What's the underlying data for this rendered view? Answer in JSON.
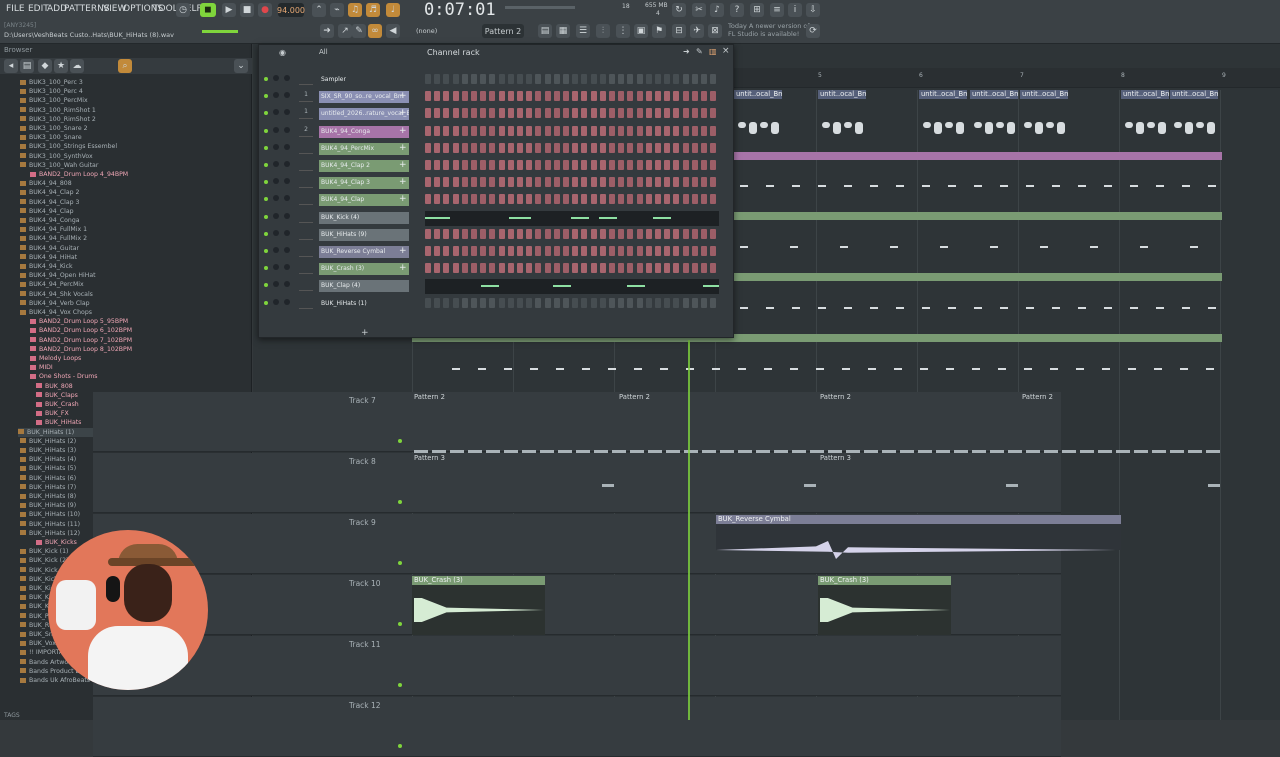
{
  "menu": [
    "FILE",
    "EDIT",
    "ADD",
    "PATTERNS",
    "VIEW",
    "OPTIONS",
    "TOOLS",
    "HELP"
  ],
  "tempo": "94.000",
  "clock": "0:07:01",
  "cpu": "18",
  "mem": "655 MB",
  "voices": "4",
  "pattern": "Pattern 2",
  "snap": "(none)",
  "hint": "[ANY3245]",
  "path": "D:\\Users\\VeshBeats Custo..Hats\\BUK_HiHats (8).wav",
  "news": [
    "Today  A newer version of",
    "FL Studio is available!"
  ],
  "browser": {
    "title": "Browser",
    "items": [
      "BUK3_100_Perc 3",
      "BUK3_100_Perc 4",
      "BUK3_100_PercMix",
      "BUK3_100_RimShot 1",
      "BUK3_100_RimShot 2",
      "BUK3_100_Snare 2",
      "BUK3_100_Snare",
      "BUK3_100_Strings Essembel",
      "BUK3_100_SynthVox",
      "BUK3_100_Wah Guitar",
      "BAND2_Drum Loop 4_94BPM",
      "BUK4_94_808",
      "BUK4_94_Clap 2",
      "BUK4_94_Clap 3",
      "BUK4_94_Clap",
      "BUK4_94_Conga",
      "BUK4_94_FullMix 1",
      "BUK4_94_FullMix 2",
      "BUK4_94_Guitar",
      "BUK4_94_HiHat",
      "BUK4_94_Kick",
      "BUK4_94_Open HiHat",
      "BUK4_94_PercMix",
      "BUK4_94_Shk Vocals",
      "BUK4_94_Verb Clap",
      "BUK4_94_Vox Chops",
      "BAND2_Drum Loop 5_95BPM",
      "BAND2_Drum Loop 6_102BPM",
      "BAND2_Drum Loop 7_102BPM",
      "BAND2_Drum Loop 8_102BPM",
      "Melody Loops",
      "MIDI",
      "One Shots - Drums",
      "BUK_808",
      "BUK_Claps",
      "BUK_Crash",
      "BUK_FX",
      "BUK_HiHats",
      "BUK_HiHats (1)",
      "BUK_HiHats (2)",
      "BUK_HiHats (3)",
      "BUK_HiHats (4)",
      "BUK_HiHats (5)",
      "BUK_HiHats (6)",
      "BUK_HiHats (7)",
      "BUK_HiHats (8)",
      "BUK_HiHats (9)",
      "BUK_HiHats (10)",
      "BUK_HiHats (11)",
      "BUK_HiHats (12)",
      "BUK_Kicks",
      "BUK_Kick (1)",
      "BUK_Kick (2)",
      "BUK_Kick (3)",
      "BUK_Kick (4)",
      "BUK_Kick (5)",
      "BUK_Kick (6)",
      "BUK_Kick (7)",
      "BUK_P",
      "BUK_Ri",
      "BUK_Sna",
      "BUK_Vox",
      "!! IMPORTANT MESSAGE - …  AFROSWING DRUM KIT",
      "Bands Artwork 7",
      "Bands Product Details",
      "Bands Uk AfroBeats x AfroSwing DEMO Track"
    ],
    "tags": "TAGS"
  },
  "rack": {
    "title": "Channel rack",
    "filter": "All",
    "channels": [
      {
        "num": "",
        "name": "Sampler",
        "color": "#343a3e",
        "mode": "steps"
      },
      {
        "num": "1",
        "name": "SIX_SR_90_so..re_vocal_Bm",
        "color": "#8a8fb3",
        "mode": "steps"
      },
      {
        "num": "1",
        "name": "untitled_2026..rature_vocal_Bm",
        "color": "#8a8fb3",
        "mode": "steps"
      },
      {
        "num": "2",
        "name": "BUK4_94_Conga",
        "color": "#a774a8",
        "mode": "steps"
      },
      {
        "num": "",
        "name": "BUK4_94_PercMix",
        "color": "#7a9b73",
        "mode": "steps"
      },
      {
        "num": "",
        "name": "BUK4_94_Clap 2",
        "color": "#7a9b73",
        "mode": "steps"
      },
      {
        "num": "",
        "name": "BUK4_94_Clap 3",
        "color": "#7a9b73",
        "mode": "steps"
      },
      {
        "num": "",
        "name": "BUK4_94_Clap",
        "color": "#7a9b73",
        "mode": "steps"
      },
      {
        "num": "",
        "name": "BUK_Kick (4)",
        "color": "#6a7378",
        "mode": "roll"
      },
      {
        "num": "",
        "name": "BUK_HiHats (9)",
        "color": "#6a7378",
        "mode": "steps"
      },
      {
        "num": "",
        "name": "BUK_Reverse Cymbal",
        "color": "#7c7e96",
        "mode": "steps"
      },
      {
        "num": "",
        "name": "BUK_Crash (3)",
        "color": "#7a9b73",
        "mode": "steps"
      },
      {
        "num": "",
        "name": "BUK_Clap (4)",
        "color": "#6a7378",
        "mode": "roll"
      },
      {
        "num": "",
        "name": "BUK_HiHats (1)",
        "color": "#343a3e",
        "mode": "steps"
      }
    ]
  },
  "playlist": {
    "bar_numbers": [
      "5",
      "6",
      "7",
      "8",
      "9"
    ],
    "vocal_clip": "untit..ocal_Bm",
    "tracks": [
      {
        "label": "Track 7",
        "clip": "Pattern 2"
      },
      {
        "label": "Track 8",
        "clip": "Pattern 3"
      },
      {
        "label": "Track 9",
        "clip": "BUK_Reverse Cymbal"
      },
      {
        "label": "Track 10",
        "clip": "BUK_Crash (3)"
      },
      {
        "label": "Track 11",
        "clip": ""
      },
      {
        "label": "Track 12",
        "clip": ""
      }
    ]
  },
  "colors": {
    "accent": "#7fd53c",
    "clip_green": "#7a9b73",
    "clip_purple": "#a774a8",
    "clip_lavender": "#7c7e96"
  }
}
